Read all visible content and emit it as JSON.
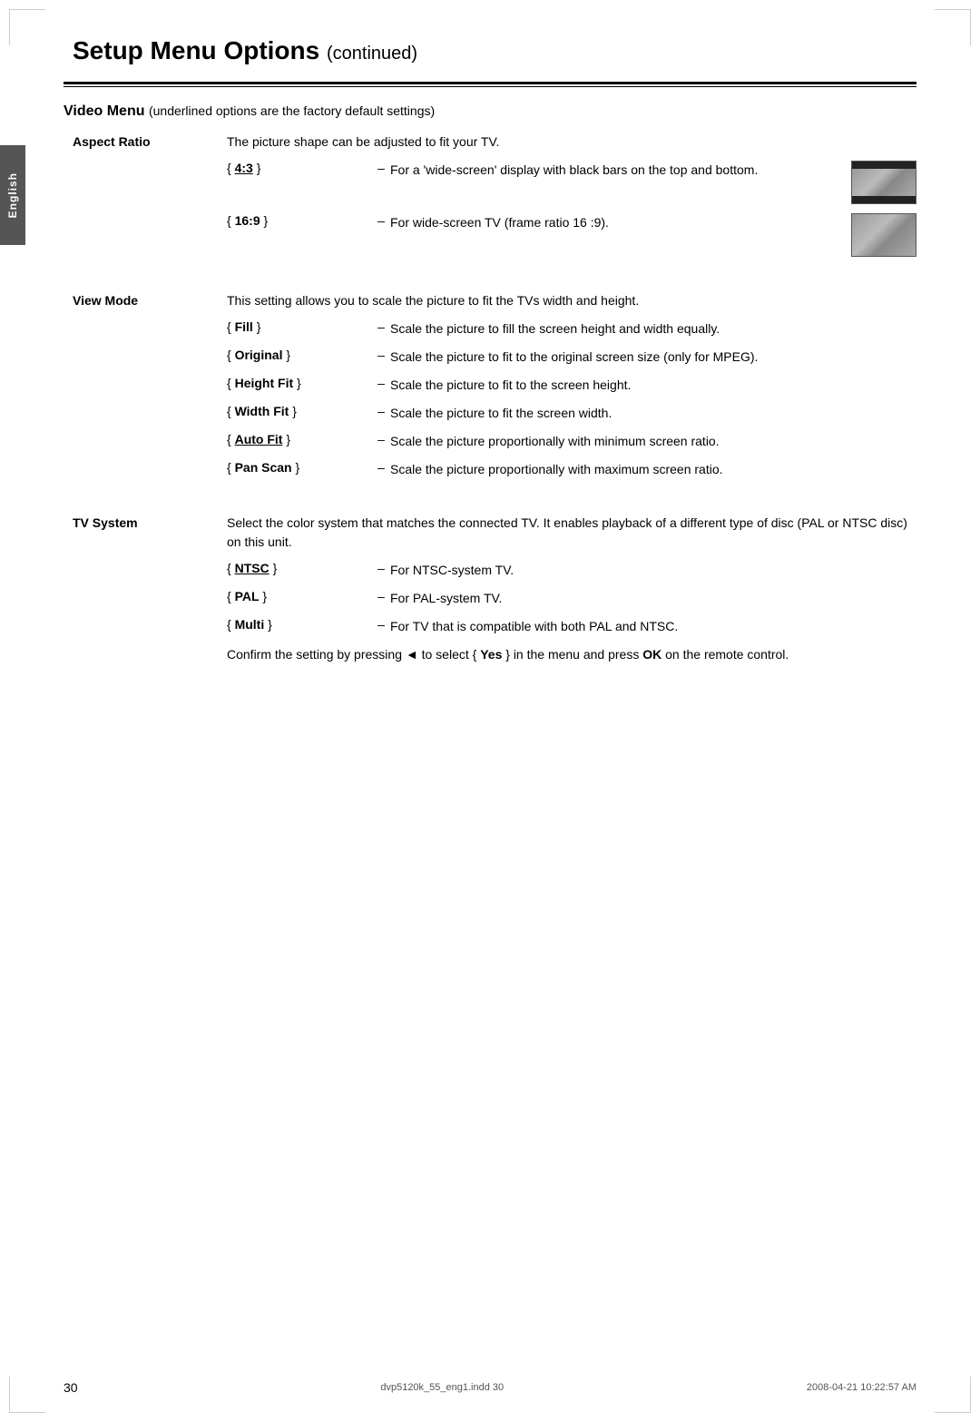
{
  "page": {
    "title": "Setup Menu Options",
    "title_continued": "(continued)",
    "page_number": "30",
    "footer_filename": "dvp5120k_55_eng1.indd   30",
    "footer_date": "2008-04-21   10:22:57 AM"
  },
  "side_tab": {
    "label": "English"
  },
  "video_menu": {
    "heading": "Video Menu",
    "subheading": "(underlined options are the factory default settings)"
  },
  "sections": [
    {
      "id": "aspect-ratio",
      "label": "Aspect Ratio",
      "description": "The picture shape can be adjusted to fit your TV.",
      "options": [
        {
          "key": "4:3",
          "underlined": true,
          "dash": "–",
          "description": "For a 'wide-screen' display with black bars on the top and bottom.",
          "has_image": true,
          "image_type": "4:3"
        },
        {
          "key": "16:9",
          "underlined": false,
          "dash": "–",
          "description": "For wide-screen TV (frame ratio 16 :9).",
          "has_image": true,
          "image_type": "16:9"
        }
      ]
    },
    {
      "id": "view-mode",
      "label": "View Mode",
      "description": "This setting allows you to scale the picture to fit the TVs width and height.",
      "options": [
        {
          "key": "Fill",
          "underlined": false,
          "dash": "–",
          "description": "Scale the picture to fill the screen height and width equally."
        },
        {
          "key": "Original",
          "underlined": false,
          "dash": "–",
          "description": "Scale the picture to fit to the original screen size (only for MPEG)."
        },
        {
          "key": "Height Fit",
          "underlined": false,
          "dash": "–",
          "description": "Scale the picture to fit to the screen height."
        },
        {
          "key": "Width Fit",
          "underlined": false,
          "dash": "–",
          "description": "Scale the picture to fit the screen width."
        },
        {
          "key": "Auto Fit",
          "underlined": true,
          "dash": "–",
          "description": "Scale the picture proportionally with minimum screen ratio."
        },
        {
          "key": "Pan Scan",
          "underlined": false,
          "dash": "–",
          "description": "Scale the picture proportionally with maximum screen ratio."
        }
      ]
    },
    {
      "id": "tv-system",
      "label": "TV System",
      "description": "Select the color system that matches the connected TV. It enables playback of a different type of disc (PAL or NTSC disc) on this unit.",
      "options": [
        {
          "key": "NTSC",
          "underlined": true,
          "dash": "–",
          "description": "For NTSC-system TV."
        },
        {
          "key": "PAL",
          "underlined": false,
          "dash": "–",
          "description": "For PAL-system TV."
        },
        {
          "key": "Multi",
          "underlined": false,
          "dash": "–",
          "description": "For TV that is compatible with both PAL and NTSC."
        }
      ],
      "confirm_note": "Confirm the setting by pressing ◄ to select { Yes } in the menu and press OK on the remote control."
    }
  ]
}
